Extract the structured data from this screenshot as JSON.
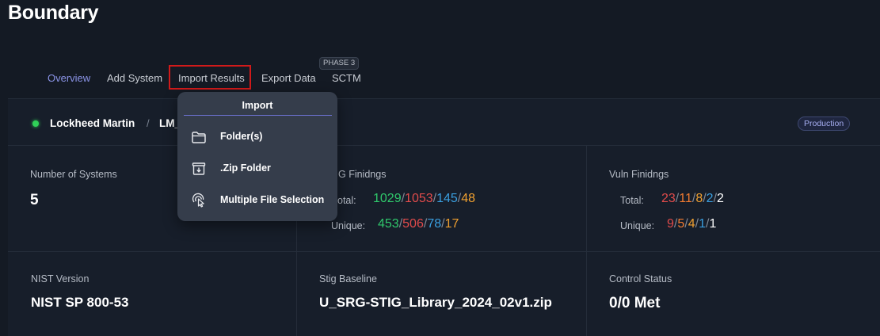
{
  "app": {
    "title": "Boundary"
  },
  "nav": {
    "phase_badge": "PHASE 3",
    "tabs": [
      {
        "label": "Overview"
      },
      {
        "label": "Add System"
      },
      {
        "label": "Import Results"
      },
      {
        "label": "Export Data"
      },
      {
        "label": "SCTM"
      }
    ]
  },
  "header": {
    "org": "Lockheed Martin",
    "separator": "/",
    "system": "LM_",
    "env_badge": "Production",
    "status_color": "#30d158"
  },
  "stats": {
    "systems": {
      "label": "Number of Systems",
      "value": "5"
    },
    "stig": {
      "label": "G Finidngs",
      "total_label": "otal:",
      "total": [
        "1029",
        "1053",
        "145",
        "48"
      ],
      "unique_label": "Unique:",
      "unique": [
        "453",
        "506",
        "78",
        "17"
      ]
    },
    "vuln": {
      "label": "Vuln Finidngs",
      "total_label": "Total:",
      "total": [
        "23",
        "11",
        "8",
        "2",
        "2"
      ],
      "unique_label": "Unique:",
      "unique": [
        "9",
        "5",
        "4",
        "1",
        "1"
      ]
    },
    "severity_colors": [
      "#2fc76b",
      "#e04b4b",
      "#3a9fe0",
      "#f0a030",
      "#ffffff"
    ]
  },
  "info": {
    "nist": {
      "label": "NIST Version",
      "value": "NIST SP 800-53"
    },
    "baseline": {
      "label": "Stig Baseline",
      "value": "U_SRG-STIG_Library_2024_02v1.zip"
    },
    "control": {
      "label": "Control Status",
      "value": "0/0 Met"
    }
  },
  "import_menu": {
    "title": "Import",
    "items": [
      {
        "label": "Folder(s)",
        "icon": "folder-icon"
      },
      {
        "label": ".Zip Folder",
        "icon": "zip-folder-icon"
      },
      {
        "label": "Multiple File Selection",
        "icon": "multi-select-icon"
      }
    ]
  },
  "accent": "#8a93e6",
  "highlight_color": "#d11a1a"
}
